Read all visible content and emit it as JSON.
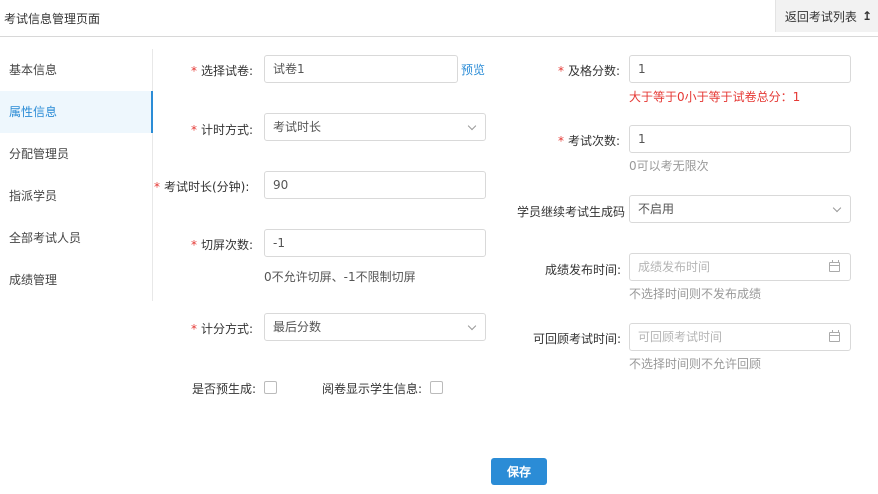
{
  "header": {
    "title": "考试信息管理页面",
    "back_label": "返回考试列表",
    "back_icon": "↥"
  },
  "sidebar": {
    "items": [
      {
        "label": "基本信息",
        "active": false
      },
      {
        "label": "属性信息",
        "active": true
      },
      {
        "label": "分配管理员",
        "active": false
      },
      {
        "label": "指派学员",
        "active": false
      },
      {
        "label": "全部考试人员",
        "active": false
      },
      {
        "label": "成绩管理",
        "active": false
      }
    ]
  },
  "form": {
    "required_mark": "*",
    "paper": {
      "label": "选择试卷:",
      "value": "试卷1",
      "preview_label": "预览"
    },
    "timing_mode": {
      "label": "计时方式:",
      "value": "考试时长"
    },
    "duration": {
      "label": "考试时长(分钟):",
      "value": "90"
    },
    "switch_count": {
      "label": "切屏次数:",
      "value": "-1",
      "hint": "0不允许切屏、-1不限制切屏"
    },
    "score_mode": {
      "label": "计分方式:",
      "value": "最后分数"
    },
    "pre_generate": {
      "label": "是否预生成:"
    },
    "show_student_info": {
      "label": "阅卷显示学生信息:"
    },
    "pass_score": {
      "label": "及格分数:",
      "value": "1",
      "error": "大于等于0小于等于试卷总分：1"
    },
    "attempts": {
      "label": "考试次数:",
      "value": "1",
      "hint": "0可以考无限次"
    },
    "continue_score": {
      "label": "学员继续考试生成码",
      "value": "不启用"
    },
    "publish_time": {
      "label": "成绩发布时间:",
      "placeholder": "成绩发布时间",
      "hint": "不选择时间则不发布成绩"
    },
    "review_time": {
      "label": "可回顾考试时间:",
      "placeholder": "可回顾考试时间",
      "hint": "不选择时间则不允许回顾"
    },
    "save_label": "保存"
  },
  "colors": {
    "accent": "#2b8cd6",
    "error": "#e53935",
    "active_bg": "#eef7fd"
  }
}
